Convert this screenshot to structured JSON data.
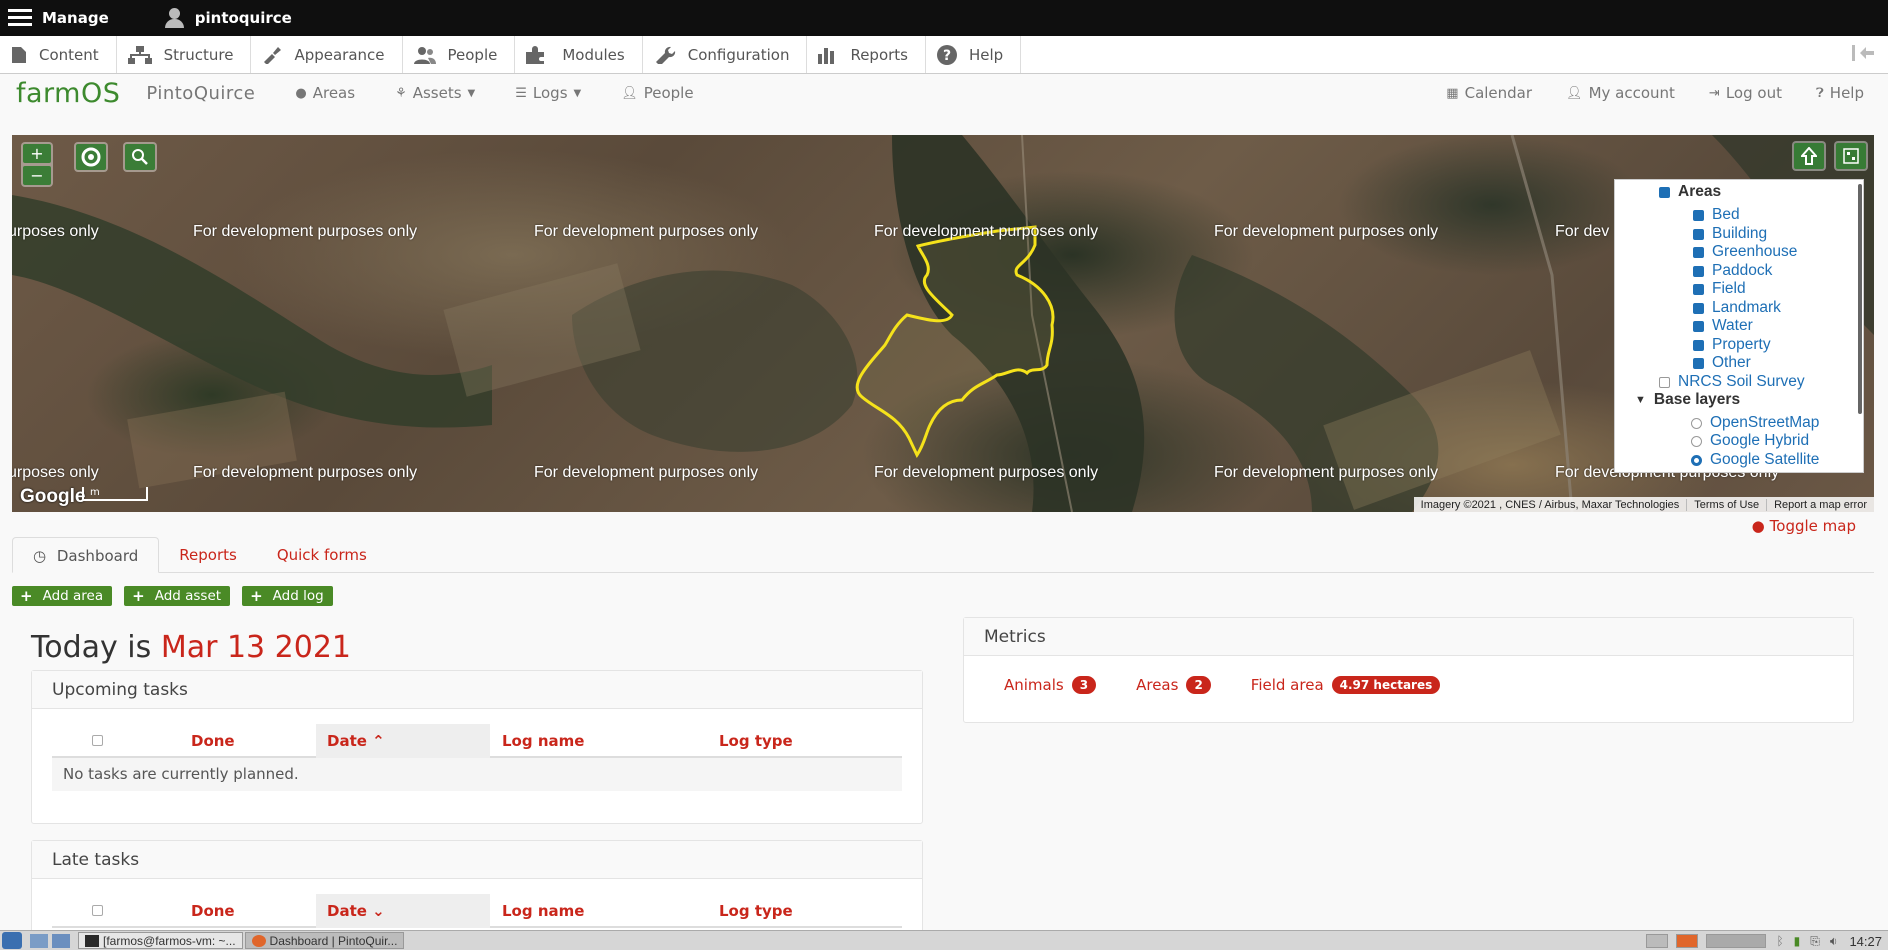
{
  "admin_bar": {
    "manage_label": "Manage",
    "user_label": "pintoquirce"
  },
  "admin_tray": {
    "items": [
      {
        "label": "Content",
        "icon": "file-icon"
      },
      {
        "label": "Structure",
        "icon": "sitemap-icon"
      },
      {
        "label": "Appearance",
        "icon": "paintbrush-icon"
      },
      {
        "label": "People",
        "icon": "people-icon"
      },
      {
        "label": "Modules",
        "icon": "puzzle-icon"
      },
      {
        "label": "Configuration",
        "icon": "wrench-icon"
      },
      {
        "label": "Reports",
        "icon": "bar-chart-icon"
      },
      {
        "label": "Help",
        "icon": "question-icon"
      }
    ]
  },
  "navbar": {
    "brand": "farmOS",
    "site_name": "PintoQuirce",
    "links": {
      "areas": "Areas",
      "assets": "Assets",
      "logs": "Logs",
      "people": "People",
      "calendar": "Calendar",
      "my_account": "My account",
      "log_out": "Log out",
      "help": "Help"
    }
  },
  "map": {
    "watermark_text": "For development purposes only",
    "watermark_partial": "urposes only",
    "watermark_partial_right": "For dev",
    "watermark_partial_right2": "For development purposes only",
    "zoom_in": "+",
    "zoom_out": "−",
    "google_logo": "Google",
    "scale_label": "m",
    "attribution": {
      "imagery": "Imagery ©2021 , CNES / Airbus, Maxar Technologies",
      "terms": "Terms of Use",
      "report": "Report a map error"
    },
    "layers": {
      "areas_label": "Areas",
      "area_types": [
        "Bed",
        "Building",
        "Greenhouse",
        "Paddock",
        "Field",
        "Landmark",
        "Water",
        "Property",
        "Other"
      ],
      "nrcs_label": "NRCS Soil Survey",
      "base_layers_label": "Base layers",
      "base_layers": [
        {
          "label": "OpenStreetMap",
          "selected": false
        },
        {
          "label": "Google Hybrid",
          "selected": false
        },
        {
          "label": "Google Satellite",
          "selected": true
        }
      ]
    },
    "toggle_label": "Toggle map"
  },
  "tabs": {
    "dashboard": "Dashboard",
    "reports": "Reports",
    "quick_forms": "Quick forms"
  },
  "actions": {
    "add_area": "Add area",
    "add_asset": "Add asset",
    "add_log": "Add log"
  },
  "today": {
    "prefix": "Today is",
    "date": "Mar 13 2021"
  },
  "upcoming_tasks": {
    "title": "Upcoming tasks",
    "columns": {
      "done": "Done",
      "date": "Date",
      "log_name": "Log name",
      "log_type": "Log type"
    },
    "empty_message": "No tasks are currently planned."
  },
  "late_tasks": {
    "title": "Late tasks",
    "columns": {
      "done": "Done",
      "date": "Date",
      "log_name": "Log name",
      "log_type": "Log type"
    }
  },
  "metrics": {
    "title": "Metrics",
    "animals_label": "Animals",
    "animals_count": "3",
    "areas_label": "Areas",
    "areas_count": "2",
    "field_area_label": "Field area",
    "field_area_value": "4.97 hectares"
  },
  "taskbar": {
    "terminal": "[farmos@farmos-vm: ~...",
    "browser": "Dashboard | PintoQuir...",
    "clock": "14:27"
  },
  "colors": {
    "accent_red": "#c9261b",
    "brand_green": "#3d8a2e",
    "button_green": "#4a8a26",
    "polygon_yellow": "#f5e21b"
  }
}
